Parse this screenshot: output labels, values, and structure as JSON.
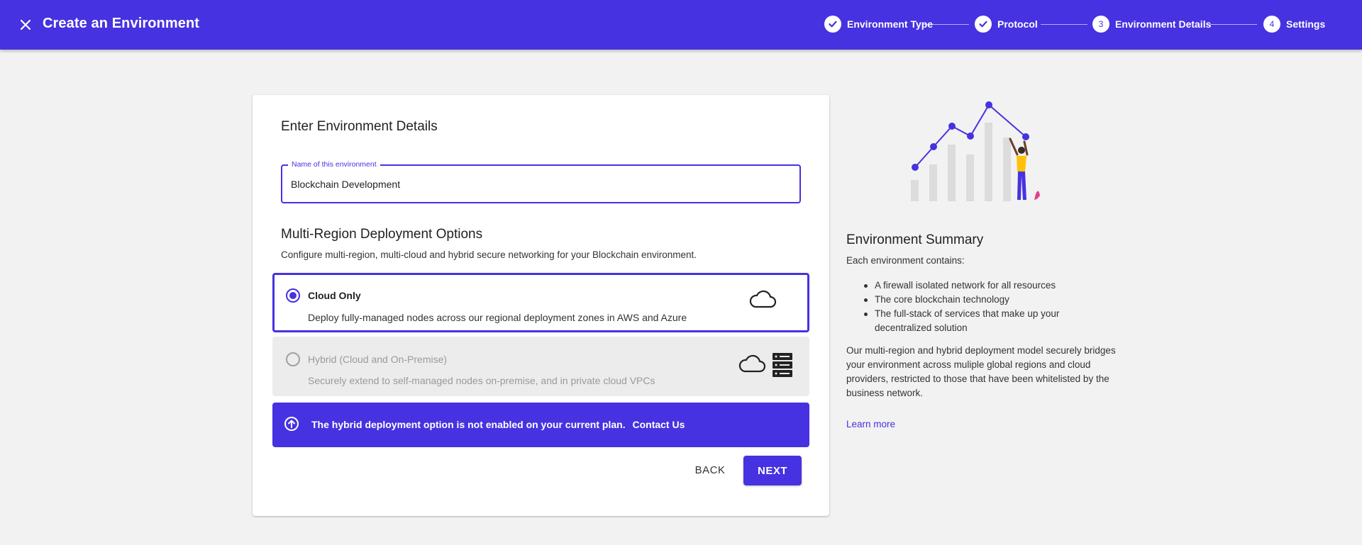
{
  "header": {
    "title": "Create an Environment",
    "close_icon": "close-icon"
  },
  "stepper": {
    "steps": [
      {
        "label": "Environment Type",
        "marker": "",
        "status": "complete"
      },
      {
        "label": "Protocol",
        "marker": "",
        "status": "complete"
      },
      {
        "label": "Environment Details",
        "marker": "3",
        "status": "current"
      },
      {
        "label": "Settings",
        "marker": "4",
        "status": "upcoming"
      }
    ]
  },
  "form": {
    "title": "Enter Environment Details",
    "name_field": {
      "label": "Name of this environment",
      "value": "Blockchain Development"
    }
  },
  "deployment": {
    "title": "Multi-Region Deployment Options",
    "description": "Configure multi-region, multi-cloud and hybrid secure networking for your Blockchain environment.",
    "options": [
      {
        "title": "Cloud Only",
        "description": "Deploy fully-managed nodes across our regional deployment zones in AWS and Azure",
        "selected": true,
        "icon": "cloud-icon"
      },
      {
        "title": "Hybrid (Cloud and On-Premise)",
        "description": "Securely extend to self-managed nodes on-premise, and in private cloud VPCs",
        "selected": false,
        "disabled": true,
        "icons": [
          "cloud-icon",
          "server-icon"
        ]
      }
    ],
    "banner": {
      "message": "The hybrid deployment option is not enabled on your current plan.",
      "link": "Contact Us",
      "icon": "upgrade-arrow-icon"
    }
  },
  "actions": {
    "back": "BACK",
    "next": "NEXT"
  },
  "summary": {
    "title": "Environment Summary",
    "intro": "Each environment contains:",
    "items": [
      "A firewall isolated network for all resources",
      "The core blockchain technology",
      "The full-stack of services that make up your decentralized solution"
    ],
    "body": "Our multi-region and hybrid deployment model securely bridges your environment across muliple global regions and cloud providers, restricted to those that have been whitelisted by the business network.",
    "link": "Learn more"
  },
  "colors": {
    "primary": "#4632e0",
    "background": "#f2f2f2",
    "disabled": "#9a9a9a",
    "illustration_accent": "#ffc107"
  }
}
